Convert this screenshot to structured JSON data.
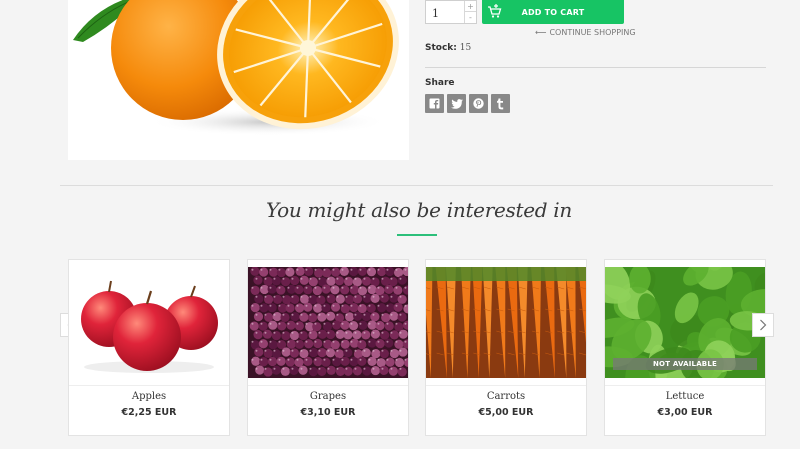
{
  "product": {
    "quantity": "1",
    "qty_plus": "+",
    "qty_minus": "-",
    "add_to_cart": "ADD TO CART",
    "continue_shopping": "CONTINUE SHOPPING",
    "stock_label": "Stock:",
    "stock_value": "15",
    "share_label": "Share"
  },
  "share_icons": [
    "facebook-icon",
    "twitter-icon",
    "pinterest-icon",
    "tumblr-icon"
  ],
  "related": {
    "title": "You might also be interested in",
    "items": [
      {
        "name": "Apples",
        "price": "€2,25 EUR",
        "image": "apples-image"
      },
      {
        "name": "Grapes",
        "price": "€3,10 EUR",
        "image": "grapes-image"
      },
      {
        "name": "Carrots",
        "price": "€5,00 EUR",
        "image": "carrots-image"
      },
      {
        "name": "Lettuce",
        "price": "€3,00 EUR",
        "image": "lettuce-image",
        "badge": "NOT AVAILABLE"
      }
    ]
  },
  "colors": {
    "accent": "#17c464",
    "underline": "#2cbf7a",
    "share_button": "#888888",
    "background": "#f4f4f4"
  }
}
